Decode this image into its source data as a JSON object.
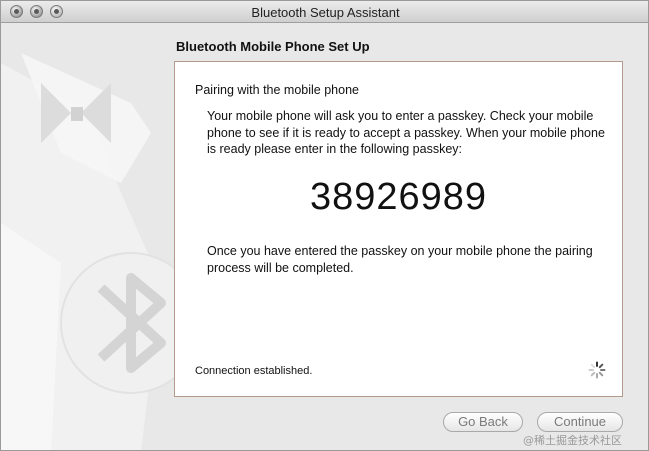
{
  "window": {
    "title": "Bluetooth Setup Assistant"
  },
  "section": {
    "heading": "Bluetooth Mobile Phone Set Up"
  },
  "panel": {
    "title": "Pairing with the mobile phone",
    "instructions": "Your mobile phone will ask you to enter a passkey. Check your mobile phone to see if it is ready to accept a passkey. When your mobile phone is ready please enter in the following passkey:",
    "passkey": "38926989",
    "completion_text": "Once you have entered the passkey on your mobile phone the pairing process will be completed.",
    "status": "Connection established."
  },
  "buttons": {
    "back": "Go Back",
    "continue": "Continue"
  },
  "watermark": "@稀土掘金技术社区",
  "icons": {
    "close": "close-button-icon",
    "minimize": "minimize-button-icon",
    "zoom": "zoom-button-icon",
    "spinner": "progress-spinner-icon",
    "bluetooth": "bluetooth-logo-icon"
  },
  "colors": {
    "window_bg": "#e8e8e8",
    "panel_border": "#b49a8a",
    "button_text": "#7a7a7a"
  }
}
